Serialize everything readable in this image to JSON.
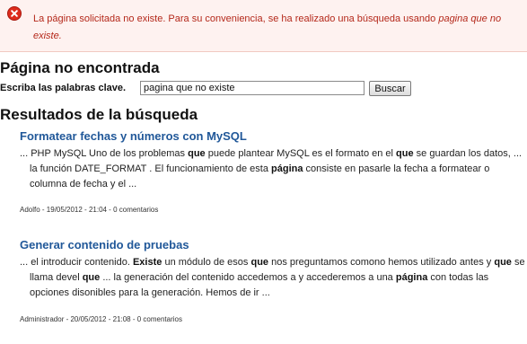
{
  "alert": {
    "message": "La página solicitada no existe. Para su conveniencia, se ha realizado una búsqueda usando",
    "query": "pagina que no existe."
  },
  "page_title": "Página no encontrada",
  "search": {
    "label": "Escriba las palabras clave.",
    "value": "pagina que no existe",
    "button_label": "Buscar"
  },
  "results_heading": "Resultados de la búsqueda",
  "results": [
    {
      "title": "Formatear fechas y números con MySQL",
      "snippet_parts": [
        {
          "t": "... PHP MySQL Uno de los problemas ",
          "b": false
        },
        {
          "t": "que",
          "b": true
        },
        {
          "t": " puede plantear MySQL es el formato en el ",
          "b": false
        },
        {
          "t": "que",
          "b": true
        },
        {
          "t": " se guardan los datos, ... la función DATE_FORMAT . El funcionamiento de esta ",
          "b": false
        },
        {
          "t": "página",
          "b": true
        },
        {
          "t": " consiste en pasarle la fecha a formatear o columna de fecha y el ...",
          "b": false
        }
      ],
      "meta": "Adolfo - 19/05/2012 - 21:04 - 0 comentarios"
    },
    {
      "title": "Generar contenido de pruebas",
      "snippet_parts": [
        {
          "t": "... el introducir contenido. ",
          "b": false
        },
        {
          "t": "Existe",
          "b": true
        },
        {
          "t": " un módulo de esos ",
          "b": false
        },
        {
          "t": "que",
          "b": true
        },
        {
          "t": " nos preguntamos comono hemos utilizado antes y ",
          "b": false
        },
        {
          "t": "que",
          "b": true
        },
        {
          "t": " se llama devel ",
          "b": false
        },
        {
          "t": "que",
          "b": true
        },
        {
          "t": " ... la generación del contenido accedemos a y accederemos a una ",
          "b": false
        },
        {
          "t": "página",
          "b": true
        },
        {
          "t": " con todas las opciones disonibles para la generación. Hemos de ir ...",
          "b": false
        }
      ],
      "meta": "Administrador - 20/05/2012 - 21:08 - 0 comentarios"
    }
  ]
}
